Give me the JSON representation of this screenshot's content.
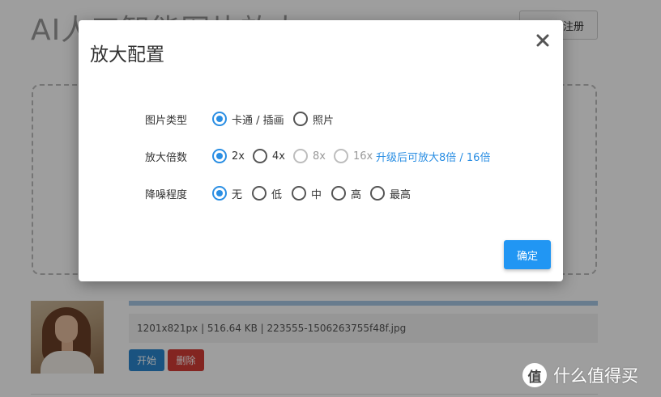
{
  "page": {
    "title": "AI人工智能图片放大",
    "register_label": "注册"
  },
  "upload_item": {
    "progress_fraction": 1.0,
    "file_info": "1201x821px | 516.64 KB | 223555-1506263755f48f.jpg",
    "start_label": "开始",
    "delete_label": "删除"
  },
  "modal": {
    "title": "放大配置",
    "close_icon": "close-icon",
    "image_type": {
      "label": "图片类型",
      "options": [
        {
          "label": "卡通 / 插画",
          "checked": true,
          "disabled": false
        },
        {
          "label": "照片",
          "checked": false,
          "disabled": false
        }
      ]
    },
    "scale": {
      "label": "放大倍数",
      "options": [
        {
          "label": "2x",
          "checked": true,
          "disabled": false
        },
        {
          "label": "4x",
          "checked": false,
          "disabled": false
        },
        {
          "label": "8x",
          "checked": false,
          "disabled": true
        },
        {
          "label": "16x",
          "checked": false,
          "disabled": true
        }
      ],
      "upgrade_link": "升级后可放大8倍 / 16倍"
    },
    "noise": {
      "label": "降噪程度",
      "options": [
        {
          "label": "无",
          "checked": true,
          "disabled": false
        },
        {
          "label": "低",
          "checked": false,
          "disabled": false
        },
        {
          "label": "中",
          "checked": false,
          "disabled": false
        },
        {
          "label": "高",
          "checked": false,
          "disabled": false
        },
        {
          "label": "最高",
          "checked": false,
          "disabled": false
        }
      ]
    },
    "confirm_label": "确定"
  },
  "watermark": {
    "logo_text": "值",
    "text": "什么值得买"
  },
  "colors": {
    "accent": "#2196f3",
    "radio_checked": "#2a8ee3",
    "start_button": "#2a87cf",
    "delete_button": "#d43c36"
  }
}
